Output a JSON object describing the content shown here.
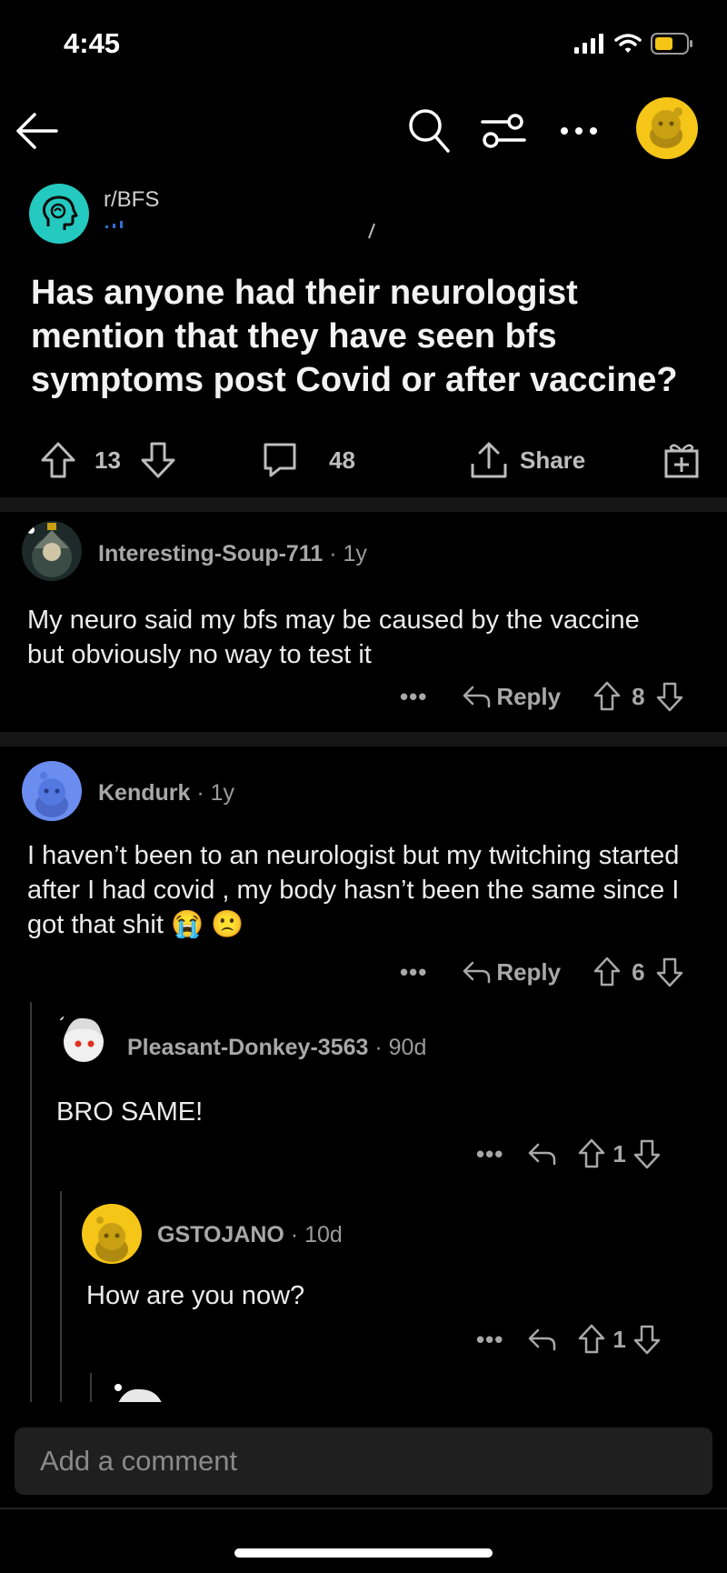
{
  "status": {
    "time": "4:45"
  },
  "subreddit": {
    "name": "r/BFS",
    "accent": "#24c9c0"
  },
  "post": {
    "title": "Has anyone had their neurologist mention that they have seen bfs symptoms post Covid or after vaccine?",
    "votes": "13",
    "comments": "48",
    "share_label": "Share"
  },
  "comments": [
    {
      "user": "Interesting-Soup-711",
      "age": "1y",
      "body": "My neuro said my bfs may be caused by the vaccine but obviously no way to test it",
      "reply_label": "Reply",
      "votes": "8"
    },
    {
      "user": "Kendurk",
      "age": "1y",
      "body": "I haven’t been to an neurologist but my twitching started after I had covid , my body hasn’t been the same since I got that shit",
      "emoji": "😭 🙁",
      "reply_label": "Reply",
      "votes": "6"
    },
    {
      "user": "Pleasant-Donkey-3563",
      "age": "90d",
      "body": "BRO SAME!",
      "votes": "1"
    },
    {
      "user": "GSTOJANO",
      "age": "10d",
      "body": "How are you now?",
      "votes": "1"
    }
  ],
  "composer": {
    "placeholder": "Add a comment"
  },
  "icons": {
    "back": "back-arrow-icon",
    "search": "search-icon",
    "sort": "sort-icon",
    "more": "more-icon",
    "avatar": "user-avatar",
    "upvote": "upvote-icon",
    "downvote": "downvote-icon",
    "comment": "comment-icon",
    "share": "share-icon",
    "award": "award-icon",
    "reply": "reply-icon"
  },
  "colors": {
    "background": "#000000",
    "snoo_yellow": "#f5c518",
    "snoo_blue": "#6b8df0"
  }
}
